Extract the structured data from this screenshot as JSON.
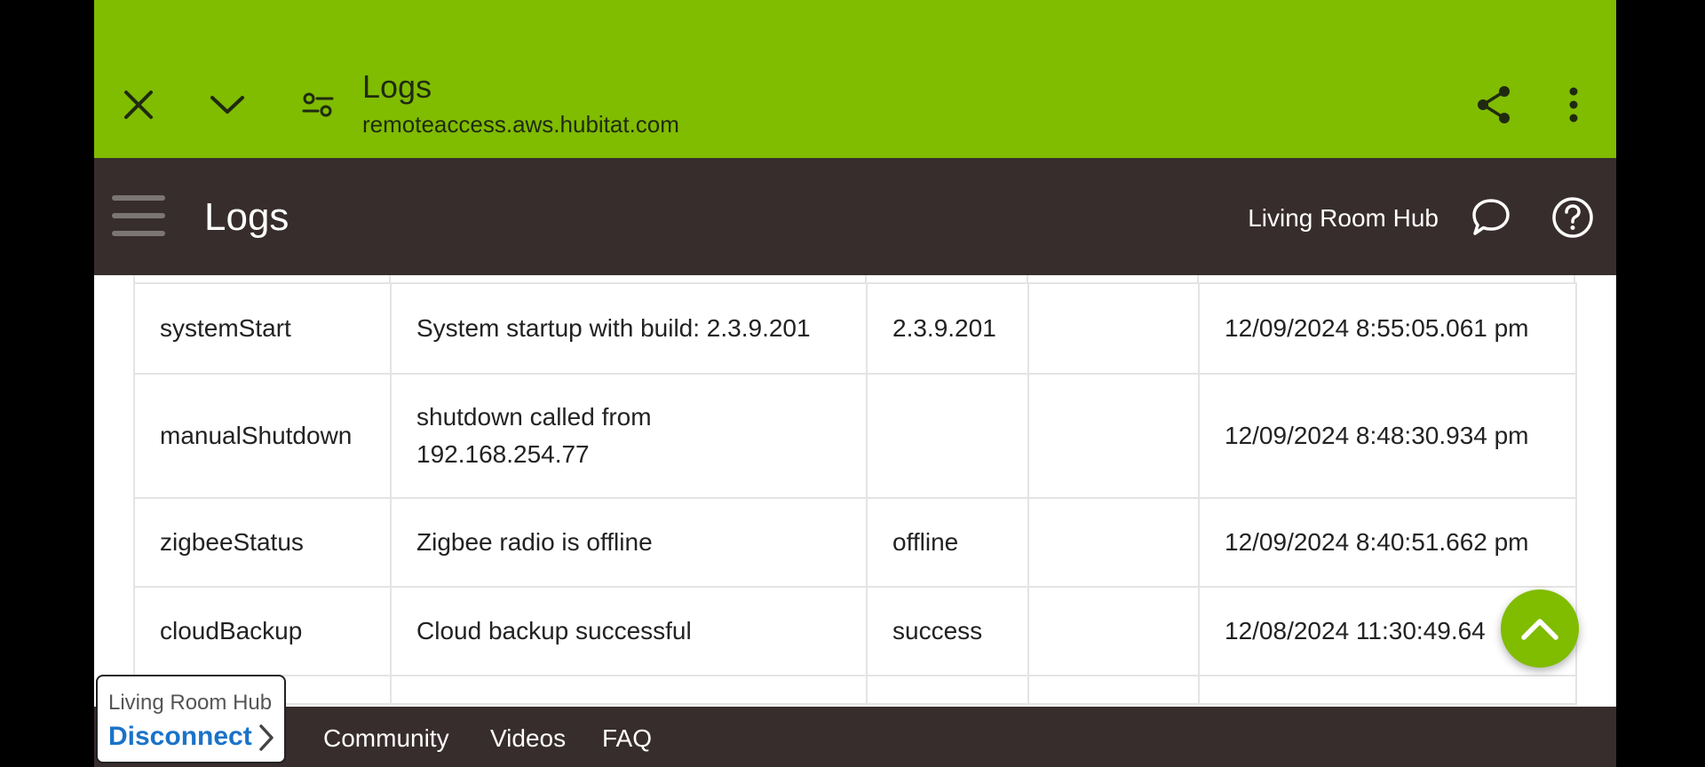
{
  "custom_tab": {
    "title": "Logs",
    "url": "remoteaccess.aws.hubitat.com",
    "icons": [
      "close-icon",
      "chevron-down-icon",
      "tune-icon",
      "share-icon",
      "more-vert-icon"
    ],
    "color": "#80bc00"
  },
  "header": {
    "title": "Logs",
    "hub_name": "Living Room Hub",
    "icons": [
      "menu-icon",
      "chat-icon",
      "help-icon"
    ],
    "color": "#372d2c"
  },
  "table": {
    "rows": [
      {
        "name": "systemStart",
        "description": "System startup with build: 2.3.9.201",
        "value": "2.3.9.201",
        "extra": "",
        "time": "12/09/2024 8:55:05.061 pm"
      },
      {
        "name": "manualShutdown",
        "description_line1": "shutdown called from",
        "description_line2": "192.168.254.77",
        "value": "",
        "extra": "",
        "time": "12/09/2024 8:48:30.934 pm"
      },
      {
        "name": "zigbeeStatus",
        "description": "Zigbee radio is offline",
        "value": "offline",
        "extra": "",
        "time": "12/09/2024 8:40:51.662 pm"
      },
      {
        "name": "cloudBackup",
        "description": "Cloud backup successful",
        "value": "success",
        "extra": "",
        "time": "12/08/2024 11:30:49.64"
      }
    ]
  },
  "fab": {
    "icon": "chevron-up-icon"
  },
  "footer": {
    "links": [
      "Community",
      "Videos",
      "FAQ"
    ],
    "hub_popup": {
      "title": "Living Room Hub",
      "action": "Disconnect"
    }
  }
}
